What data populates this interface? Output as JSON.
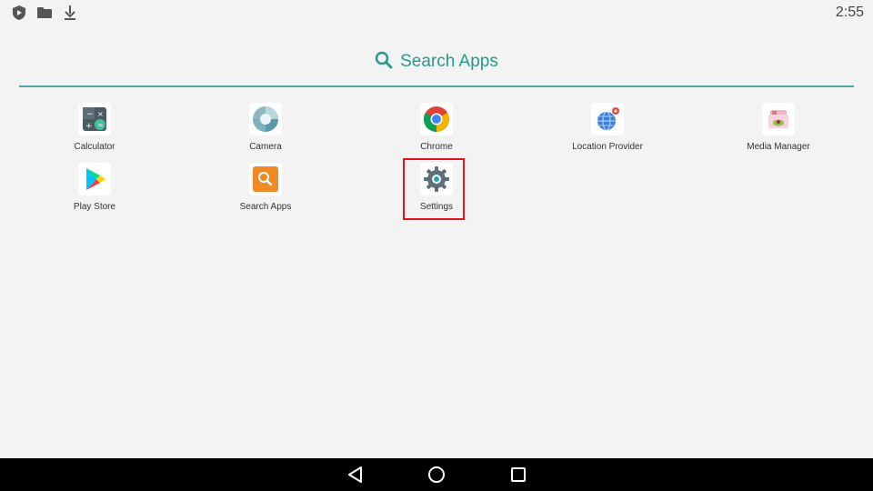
{
  "status_bar": {
    "time": "2:55",
    "icons": [
      "play-protect-icon",
      "folder-icon",
      "download-icon"
    ]
  },
  "search": {
    "label": "Search Apps",
    "accent_color": "#26998b"
  },
  "apps": [
    {
      "label": "Calculator",
      "icon": "calculator-icon"
    },
    {
      "label": "Camera",
      "icon": "camera-icon"
    },
    {
      "label": "Chrome",
      "icon": "chrome-icon"
    },
    {
      "label": "Location Provider",
      "icon": "location-provider-icon"
    },
    {
      "label": "Media Manager",
      "icon": "media-manager-icon"
    },
    {
      "label": "Play Store",
      "icon": "play-store-icon"
    },
    {
      "label": "Search Apps",
      "icon": "search-apps-icon"
    },
    {
      "label": "Settings",
      "icon": "settings-icon"
    }
  ],
  "highlighted_app": "Settings",
  "highlight_color": "#e0141e",
  "nav_bar": {
    "buttons": [
      "back",
      "home",
      "recents"
    ]
  }
}
